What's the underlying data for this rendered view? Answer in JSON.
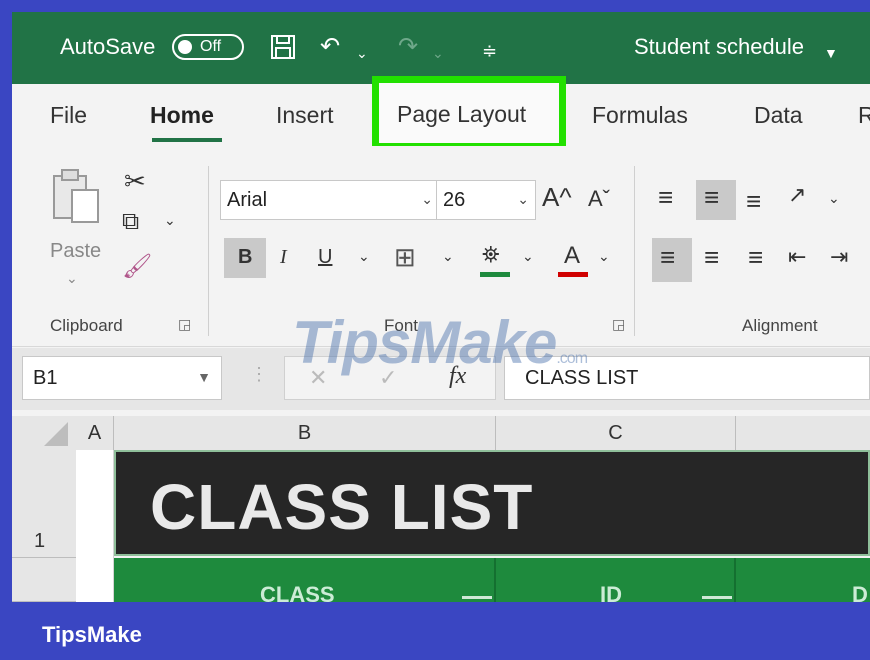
{
  "titlebar": {
    "autosave_label": "AutoSave",
    "autosave_state": "Off",
    "document_title": "Student schedule",
    "accent": "#217346"
  },
  "tabs": [
    "File",
    "Home",
    "Insert",
    "Page Layout",
    "Formulas",
    "Data",
    "R"
  ],
  "highlight_color": "#22e000",
  "ribbon": {
    "clipboard": {
      "paste_label": "Paste",
      "group_label": "Clipboard"
    },
    "font": {
      "font_name": "Arial",
      "font_size": "26",
      "bold": "B",
      "italic": "I",
      "underline": "U",
      "grow": "A^",
      "shrink": "Aˇ",
      "font_color_glyph": "A",
      "group_label": "Font"
    },
    "alignment": {
      "group_label": "Alignment"
    }
  },
  "formula_bar": {
    "name_box": "B1",
    "cancel": "✕",
    "enter": "✓",
    "fx": "fx",
    "formula": "CLASS LIST"
  },
  "grid": {
    "columns": [
      "A",
      "B",
      "C"
    ],
    "rows": [
      "1"
    ],
    "title_cell": "CLASS LIST",
    "headers": [
      "CLASS",
      "ID",
      "D"
    ]
  },
  "watermark": {
    "text": "TipsMake",
    "suffix": ".com"
  },
  "footer": {
    "brand": "TipsMake"
  }
}
